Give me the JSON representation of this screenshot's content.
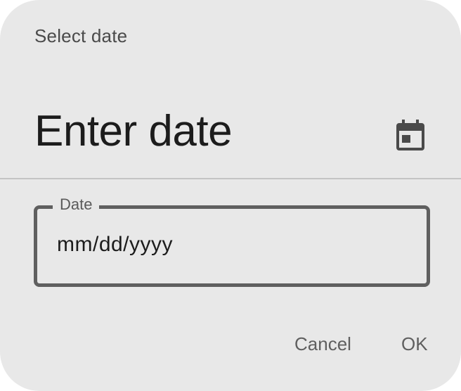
{
  "dialog": {
    "supporting_text": "Select date",
    "headline": "Enter date",
    "toggle_icon": "calendar-icon"
  },
  "date_field": {
    "label": "Date",
    "placeholder": "mm/dd/yyyy",
    "value": ""
  },
  "actions": {
    "cancel_label": "Cancel",
    "ok_label": "OK"
  },
  "colors": {
    "surface": "#e8e8e8",
    "outline": "#5f5f5f",
    "on_surface": "#1c1c1c"
  }
}
